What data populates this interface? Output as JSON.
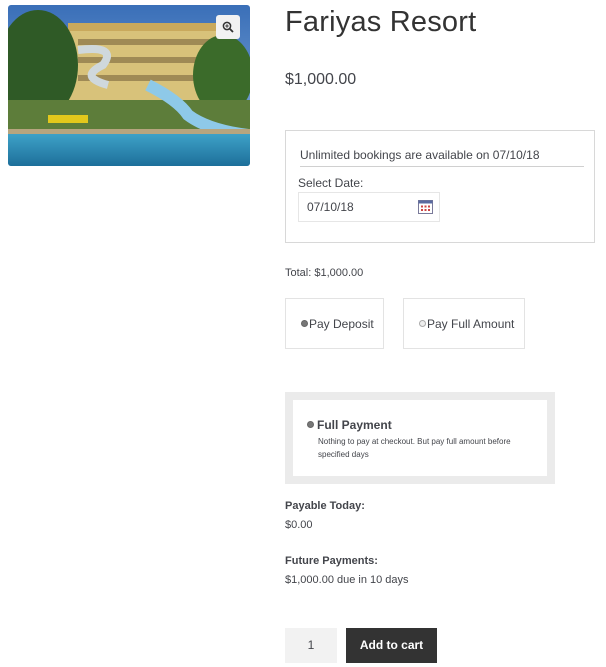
{
  "product": {
    "title": "Fariyas Resort",
    "price": "$1,000.00"
  },
  "booking": {
    "availability": "Unlimited bookings are available on 07/10/18",
    "select_date_label": "Select Date:",
    "date_value": "07/10/18"
  },
  "total": "Total: $1,000.00",
  "payment_options": [
    {
      "label": "Pay Deposit",
      "selected": true
    },
    {
      "label": "Pay Full Amount",
      "selected": false
    }
  ],
  "plan": {
    "title": "Full Payment",
    "description": "Nothing to pay at checkout. But pay full amount before specified days",
    "selected": true
  },
  "payable_today": {
    "label": "Payable Today:",
    "value": "$0.00"
  },
  "future_payments": {
    "label": "Future Payments:",
    "value": "$1,000.00 due in 10 days"
  },
  "cart": {
    "quantity": "1",
    "button_label": "Add to cart"
  },
  "icons": {
    "zoom": "zoom-in-icon",
    "calendar": "calendar-icon"
  },
  "colors": {
    "button_bg": "#333333",
    "qty_bg": "#f2f2f2"
  }
}
